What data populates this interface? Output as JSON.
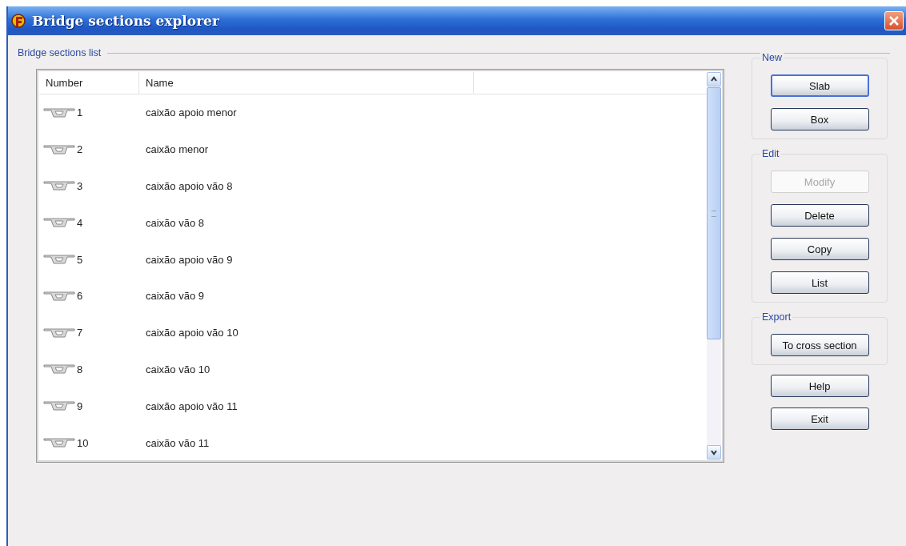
{
  "window": {
    "title": "Bridge sections explorer"
  },
  "list_group": {
    "title": "Bridge sections list"
  },
  "table": {
    "columns": [
      "Number",
      "Name"
    ],
    "rows": [
      {
        "number": "1",
        "name": "caixão apoio menor",
        "selected": false
      },
      {
        "number": "2",
        "name": "caixão menor",
        "selected": false
      },
      {
        "number": "3",
        "name": "caixão apoio vão 8",
        "selected": false
      },
      {
        "number": "4",
        "name": "caixão vão 8",
        "selected": false
      },
      {
        "number": "5",
        "name": "caixão apoio vão 9",
        "selected": false
      },
      {
        "number": "6",
        "name": "caixão vão 9",
        "selected": false
      },
      {
        "number": "7",
        "name": "caixão apoio vão 10",
        "selected": false
      },
      {
        "number": "8",
        "name": "caixão vão 10",
        "selected": false
      },
      {
        "number": "9",
        "name": "caixão apoio vão 11",
        "selected": false
      },
      {
        "number": "10",
        "name": "caixão vão 11",
        "selected": false
      }
    ]
  },
  "groups": [
    {
      "title": "New",
      "buttons": [
        {
          "label": "Slab",
          "disabled": false,
          "focused": true
        },
        {
          "label": "Box",
          "disabled": false,
          "focused": false
        }
      ]
    },
    {
      "title": "Edit",
      "buttons": [
        {
          "label": "Modify",
          "disabled": true,
          "focused": false
        },
        {
          "label": "Delete",
          "disabled": false,
          "focused": false
        },
        {
          "label": "Copy",
          "disabled": false,
          "focused": false
        },
        {
          "label": "List",
          "disabled": false,
          "focused": false
        }
      ]
    },
    {
      "title": "Export",
      "buttons": [
        {
          "label": "To cross section",
          "disabled": false,
          "focused": false
        }
      ]
    }
  ],
  "bottom_buttons": [
    {
      "label": "Help",
      "disabled": false,
      "focused": false
    },
    {
      "label": "Exit",
      "disabled": false,
      "focused": false
    }
  ]
}
